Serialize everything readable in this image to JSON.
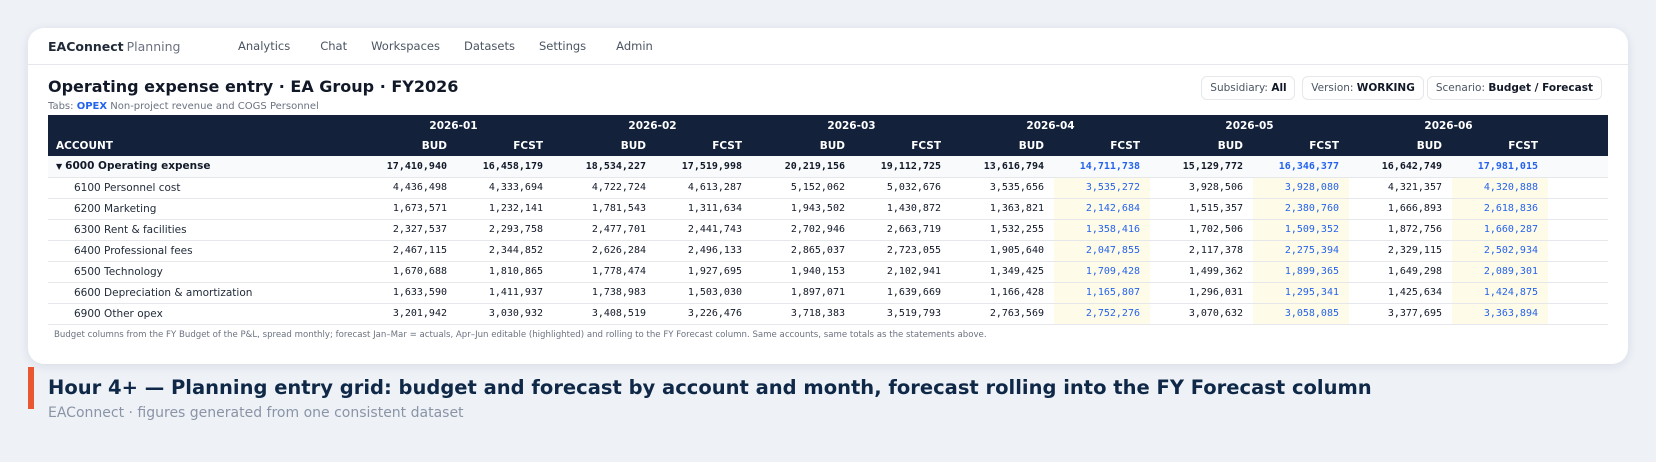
{
  "app": {
    "brand": "EAConnect",
    "brand_sub": "Planning"
  },
  "nav": [
    "Analytics",
    "Chat",
    "Workspaces",
    "Datasets",
    "Settings",
    "Admin"
  ],
  "page": {
    "title": "Operating expense entry · EA Group · FY2026",
    "tabs_label": "Tabs:",
    "tabs": [
      "OPEX",
      "Non-project revenue and COGS",
      "Personnel"
    ]
  },
  "filters": {
    "subsidiary": {
      "label": "Subsidiary:",
      "value": "All"
    },
    "version": {
      "label": "Version:",
      "value": "WORKING"
    },
    "scenario": {
      "label": "Scenario:",
      "value": "Budget / Forecast"
    }
  },
  "grid": {
    "account_header": "ACCOUNT",
    "months": [
      "2026-01",
      "2026-02",
      "2026-03",
      "2026-04",
      "2026-05",
      "2026-06"
    ],
    "col_labels": {
      "bud": "BUD",
      "fcst": "FCST"
    },
    "rows": [
      {
        "account": "6000 Operating expense",
        "total": true,
        "values": [
          "17,410,940",
          "16,458,179",
          "18,534,227",
          "17,519,998",
          "20,219,156",
          "19,112,725",
          "13,616,794",
          "14,711,738",
          "15,129,772",
          "16,346,377",
          "16,642,749",
          "17,981,015"
        ]
      },
      {
        "account": "6100 Personnel cost",
        "values": [
          "4,436,498",
          "4,333,694",
          "4,722,724",
          "4,613,287",
          "5,152,062",
          "5,032,676",
          "3,535,656",
          "3,535,272",
          "3,928,506",
          "3,928,080",
          "4,321,357",
          "4,320,888"
        ]
      },
      {
        "account": "6200 Marketing",
        "values": [
          "1,673,571",
          "1,232,141",
          "1,781,543",
          "1,311,634",
          "1,943,502",
          "1,430,872",
          "1,363,821",
          "2,142,684",
          "1,515,357",
          "2,380,760",
          "1,666,893",
          "2,618,836"
        ]
      },
      {
        "account": "6300 Rent & facilities",
        "values": [
          "2,327,537",
          "2,293,758",
          "2,477,701",
          "2,441,743",
          "2,702,946",
          "2,663,719",
          "1,532,255",
          "1,358,416",
          "1,702,506",
          "1,509,352",
          "1,872,756",
          "1,660,287"
        ]
      },
      {
        "account": "6400 Professional fees",
        "values": [
          "2,467,115",
          "2,344,852",
          "2,626,284",
          "2,496,133",
          "2,865,037",
          "2,723,055",
          "1,905,640",
          "2,047,855",
          "2,117,378",
          "2,275,394",
          "2,329,115",
          "2,502,934"
        ]
      },
      {
        "account": "6500 Technology",
        "values": [
          "1,670,688",
          "1,810,865",
          "1,778,474",
          "1,927,695",
          "1,940,153",
          "2,102,941",
          "1,349,425",
          "1,709,428",
          "1,499,362",
          "1,899,365",
          "1,649,298",
          "2,089,301"
        ]
      },
      {
        "account": "6600 Depreciation & amortization",
        "values": [
          "1,633,590",
          "1,411,937",
          "1,738,983",
          "1,503,030",
          "1,897,071",
          "1,639,669",
          "1,166,428",
          "1,165,807",
          "1,296,031",
          "1,295,341",
          "1,425,634",
          "1,424,875"
        ]
      },
      {
        "account": "6900 Other opex",
        "values": [
          "3,201,942",
          "3,030,932",
          "3,408,519",
          "3,226,476",
          "3,718,383",
          "3,519,793",
          "2,763,569",
          "2,752,276",
          "3,070,632",
          "3,058,085",
          "3,377,695",
          "3,363,894"
        ]
      }
    ],
    "editable_months": [
      "2026-04",
      "2026-05",
      "2026-06"
    ]
  },
  "footnote": "Budget columns from the FY Budget of the P&L, spread monthly; forecast Jan–Mar = actuals, Apr–Jun editable (highlighted) and rolling to the FY Forecast column. Same accounts, same totals as the statements above.",
  "caption": {
    "title": "Hour 4+ — Planning entry grid: budget and forecast by account and month, forecast rolling into the FY Forecast column",
    "subtitle": "EAConnect · figures generated from one consistent dataset"
  },
  "colors": {
    "accent": "#e8572f",
    "header_bg": "#13213b",
    "editable_bg": "#fefbe8",
    "link": "#2563eb"
  }
}
